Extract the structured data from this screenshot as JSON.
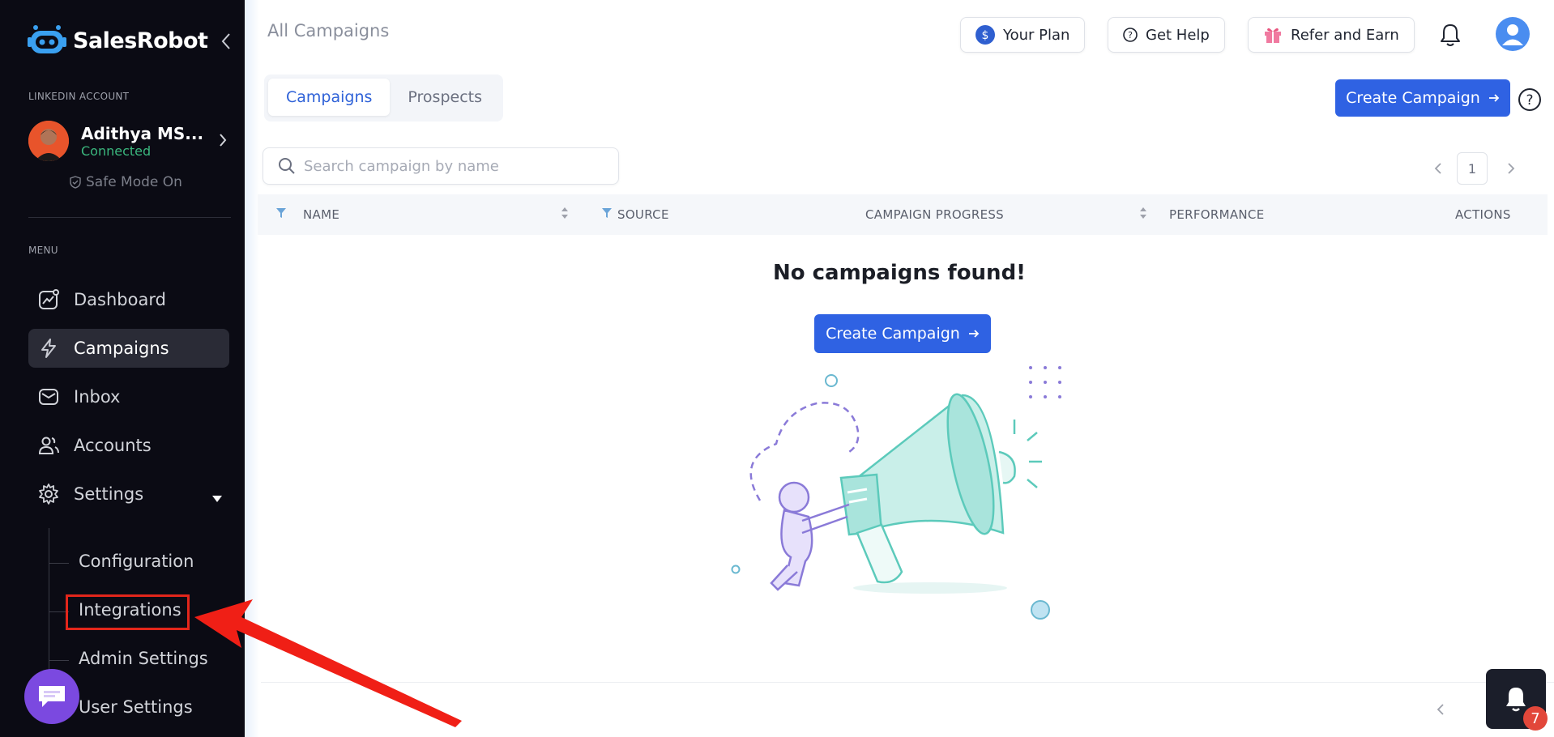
{
  "sidebar": {
    "logo_text": "SalesRobot",
    "linkedin_account_label": "LINKEDIN ACCOUNT",
    "account": {
      "name": "Adithya MS...",
      "status": "Connected",
      "safe_mode": "Safe Mode On"
    },
    "menu_label": "MENU",
    "nav": [
      {
        "label": "Dashboard",
        "icon": "dashboard-icon"
      },
      {
        "label": "Campaigns",
        "icon": "lightning-icon",
        "active": true
      },
      {
        "label": "Inbox",
        "icon": "inbox-icon"
      },
      {
        "label": "Accounts",
        "icon": "users-icon"
      },
      {
        "label": "Settings",
        "icon": "gear-icon",
        "expanded": true
      }
    ],
    "settings_sub": [
      "Configuration",
      "Integrations",
      "Admin Settings",
      "User Settings"
    ]
  },
  "header": {
    "title": "All Campaigns",
    "buttons": {
      "plan": "Your Plan",
      "help": "Get Help",
      "refer": "Refer and Earn"
    }
  },
  "tabs": [
    "Campaigns",
    "Prospects"
  ],
  "create_campaign_label": "Create Campaign",
  "search": {
    "placeholder": "Search campaign by name",
    "value": ""
  },
  "pagination": {
    "current_page": "1"
  },
  "table": {
    "columns": [
      "NAME",
      "SOURCE",
      "CAMPAIGN PROGRESS",
      "PERFORMANCE",
      "ACTIONS"
    ]
  },
  "empty_state": {
    "title": "No campaigns found!",
    "button": "Create Campaign"
  },
  "notifications": {
    "count": "7"
  },
  "colors": {
    "primary": "#2f62e3",
    "sidebar_bg": "#0b0b14",
    "connected": "#3bb77e",
    "highlight": "#e3261b"
  }
}
